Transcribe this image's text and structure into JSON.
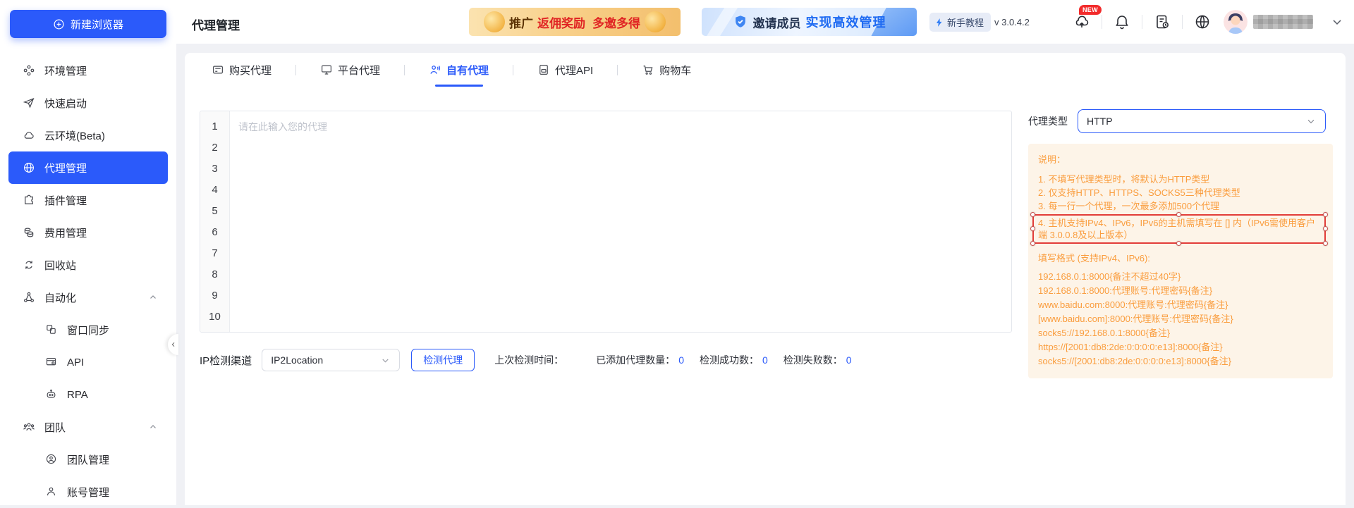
{
  "sidebar": {
    "new_browser_button": "新建浏览器",
    "items": [
      {
        "label": "环境管理"
      },
      {
        "label": "快速启动"
      },
      {
        "label": "云环境(Beta)"
      },
      {
        "label": "代理管理"
      },
      {
        "label": "插件管理"
      },
      {
        "label": "费用管理"
      },
      {
        "label": "回收站"
      },
      {
        "label": "自动化"
      },
      {
        "label": "窗口同步"
      },
      {
        "label": "API"
      },
      {
        "label": "RPA"
      },
      {
        "label": "团队"
      },
      {
        "label": "团队管理"
      },
      {
        "label": "账号管理"
      }
    ]
  },
  "header": {
    "title": "代理管理",
    "promo1": {
      "prefix": "推广",
      "highlight": "返佣奖励",
      "suffix": "多邀多得"
    },
    "promo2": {
      "prefix": "邀请成员",
      "highlight": "实现高效管理"
    },
    "tutorial": "新手教程",
    "version": "v 3.0.4.2",
    "new_badge": "NEW"
  },
  "tabs": [
    {
      "label": "购买代理"
    },
    {
      "label": "平台代理"
    },
    {
      "label": "自有代理"
    },
    {
      "label": "代理API"
    },
    {
      "label": "购物车"
    }
  ],
  "editor": {
    "placeholder": "请在此输入您的代理",
    "lines": [
      "1",
      "2",
      "3",
      "4",
      "5",
      "6",
      "7",
      "8",
      "9",
      "10"
    ]
  },
  "proxy_type": {
    "label": "代理类型",
    "value": "HTTP"
  },
  "instructions": {
    "title": "说明：",
    "items": [
      "1. 不填写代理类型时，将默认为HTTP类型",
      "2. 仅支持HTTP、HTTPS、SOCKS5三种代理类型",
      "3. 每一行一个代理，一次最多添加500个代理",
      "4. 主机支持IPv4、IPv6，IPv6的主机需填写在 [] 内（IPv6需使用客户端 3.0.0.8及以上版本）"
    ],
    "formats_title": "填写格式 (支持IPv4、IPv6):",
    "formats": [
      "192.168.0.1:8000{备注不超过40字}",
      "192.168.0.1:8000:代理账号:代理密码{备注}",
      "www.baidu.com:8000:代理账号:代理密码{备注}",
      "[www.baidu.com]:8000:代理账号:代理密码{备注}",
      "socks5://192.168.0.1:8000{备注}",
      "https://[2001:db8:2de:0:0:0:0:e13]:8000{备注}",
      "socks5://[2001:db8:2de:0:0:0:0:e13]:8000{备注}"
    ]
  },
  "footer": {
    "channel_label": "IP检测渠道",
    "channel_value": "IP2Location",
    "check_button": "检测代理",
    "last_check_label": "上次检测时间：",
    "stats": [
      {
        "label": "已添加代理数量：",
        "value": "0"
      },
      {
        "label": "检测成功数：",
        "value": "0"
      },
      {
        "label": "检测失败数：",
        "value": "0"
      }
    ]
  }
}
